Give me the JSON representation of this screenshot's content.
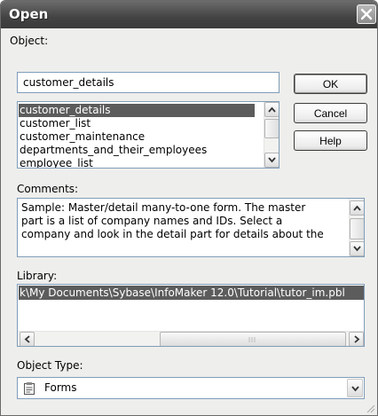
{
  "window": {
    "title": "Open"
  },
  "object": {
    "label": "Object:",
    "value": "customer_details",
    "list": [
      "customer_details",
      "customer_list",
      "customer_maintenance",
      "departments_and_their_employees",
      "employee_list"
    ],
    "selected_index": 0
  },
  "buttons": {
    "ok": "OK",
    "cancel": "Cancel",
    "help": "Help"
  },
  "comments": {
    "label": "Comments:",
    "lines": [
      "Sample: Master/detail many-to-one form. The master",
      "part is a list of company names and IDs. Select a",
      "company and look in the detail part for details about the"
    ]
  },
  "library": {
    "label": "Library:",
    "selected_path": "k\\My Documents\\Sybase\\InfoMaker 12.0\\Tutorial\\tutor_im.pbl"
  },
  "object_type": {
    "label": "Object Type:",
    "value": "Forms",
    "icon": "form-icon"
  }
}
